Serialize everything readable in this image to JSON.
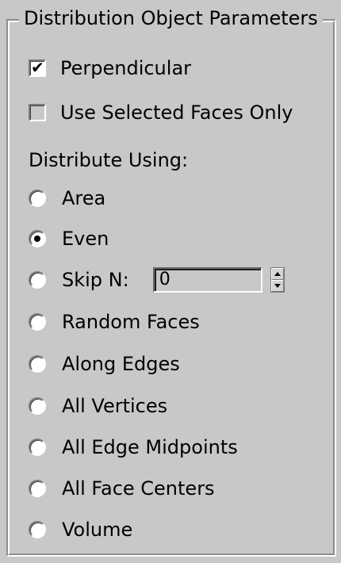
{
  "group": {
    "title": "Distribution Object Parameters"
  },
  "checkboxes": [
    {
      "label": "Perpendicular",
      "checked": true
    },
    {
      "label": "Use Selected Faces Only",
      "checked": false
    }
  ],
  "distribute_using": {
    "label": "Distribute Using:",
    "selected": "Even",
    "options": [
      {
        "label": "Area"
      },
      {
        "label": "Even"
      },
      {
        "label": "Skip N:"
      },
      {
        "label": "Random Faces"
      },
      {
        "label": "Along Edges"
      },
      {
        "label": "All Vertices"
      },
      {
        "label": "All Edge Midpoints"
      },
      {
        "label": "All Face Centers"
      },
      {
        "label": "Volume"
      }
    ]
  },
  "skip_n": {
    "value": "0"
  }
}
